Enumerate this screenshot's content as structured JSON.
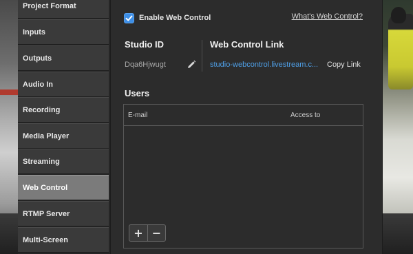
{
  "sidebar": {
    "items": [
      {
        "label": "Project Format",
        "active": false
      },
      {
        "label": "Inputs",
        "active": false
      },
      {
        "label": "Outputs",
        "active": false
      },
      {
        "label": "Audio In",
        "active": false
      },
      {
        "label": "Recording",
        "active": false
      },
      {
        "label": "Media Player",
        "active": false
      },
      {
        "label": "Streaming",
        "active": false
      },
      {
        "label": "Web Control",
        "active": true
      },
      {
        "label": "RTMP Server",
        "active": false
      },
      {
        "label": "Multi-Screen",
        "active": false
      }
    ]
  },
  "web_control": {
    "enable_label": "Enable Web Control",
    "enabled": true,
    "help_link": "What's Web Control?",
    "studio_id_title": "Studio ID",
    "studio_id_value": "Dqa6Hjwugt",
    "link_title": "Web Control Link",
    "link_value": "studio-webcontrol.livestream.c...",
    "copy_link_label": "Copy Link"
  },
  "users": {
    "title": "Users",
    "columns": [
      "E-mail",
      "Access to"
    ],
    "rows": [],
    "add_label": "+",
    "remove_label": "−"
  },
  "colors": {
    "accent": "#3d8ee6",
    "link": "#4fa0e8",
    "active_nav": "#7b7b7b"
  }
}
